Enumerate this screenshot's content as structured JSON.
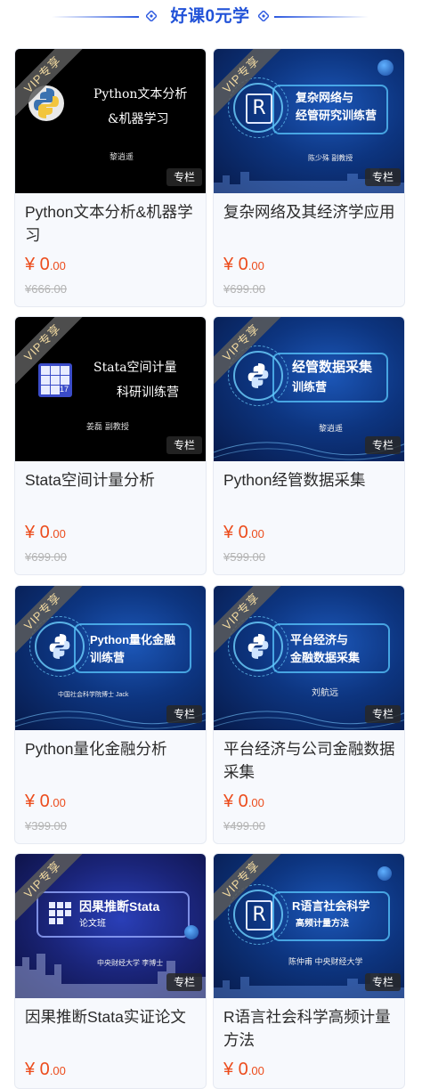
{
  "header": {
    "title": "好课0元学"
  },
  "badges": {
    "vip": "VIP专享",
    "type": "专栏"
  },
  "courses": [
    {
      "title": "Python文本分析&机器学习",
      "price_int": "¥ 0",
      "price_dec": ".00",
      "orig": "¥666.00",
      "thumb_line1": "Python文本分析",
      "thumb_line2": "&机器学习",
      "thumb_author": "黎逍遥"
    },
    {
      "title": "复杂网络及其经济学应用",
      "price_int": "¥ 0",
      "price_dec": ".00",
      "orig": "¥699.00",
      "thumb_line1": "复杂网络与",
      "thumb_line2": "经管研究训练营",
      "thumb_author": "陈少殊  副教授"
    },
    {
      "title": "Stata空间计量分析",
      "price_int": "¥ 0",
      "price_dec": ".00",
      "orig": "¥699.00",
      "thumb_line1": "Stata空间计量",
      "thumb_line2": "科研训练营",
      "thumb_author": "姜磊  副教授",
      "thumb_icon_num": "17"
    },
    {
      "title": "Python经管数据采集",
      "price_int": "¥ 0",
      "price_dec": ".00",
      "orig": "¥599.00",
      "thumb_line1": "经管数据采集",
      "thumb_line2": "训练营",
      "thumb_author": "黎逍遥"
    },
    {
      "title": "Python量化金融分析",
      "price_int": "¥ 0",
      "price_dec": ".00",
      "orig": "¥399.00",
      "thumb_line1": "Python量化金融",
      "thumb_line2": "训练营",
      "thumb_author": "中国社会科学院博士        Jack"
    },
    {
      "title": "平台经济与公司金融数据采集",
      "price_int": "¥ 0",
      "price_dec": ".00",
      "orig": "¥499.00",
      "thumb_line1": "平台经济与",
      "thumb_line2": "金融数据采集",
      "thumb_author": "刘航远"
    },
    {
      "title": "因果推断Stata实证论文",
      "price_int": "¥ 0",
      "price_dec": ".00",
      "orig": "",
      "thumb_line1": "因果推断Stata",
      "thumb_line2": "论文班",
      "thumb_author": "中央财经大学    李博士"
    },
    {
      "title": "R语言社会科学高频计量方法",
      "price_int": "¥ 0",
      "price_dec": ".00",
      "orig": "",
      "thumb_line1": "R语言社会科学",
      "thumb_line2": "高频计量方法",
      "thumb_author": "陈仲甫        中央财经大学"
    }
  ],
  "icons": {
    "header_diamond": "diamond-icon",
    "python": "python-logo-icon",
    "stata": "stata-grid-icon",
    "r": "r-logo-icon"
  },
  "colors": {
    "accent": "#2152d8",
    "price": "#ec4c1c",
    "orig_price": "#b3b3b3"
  }
}
